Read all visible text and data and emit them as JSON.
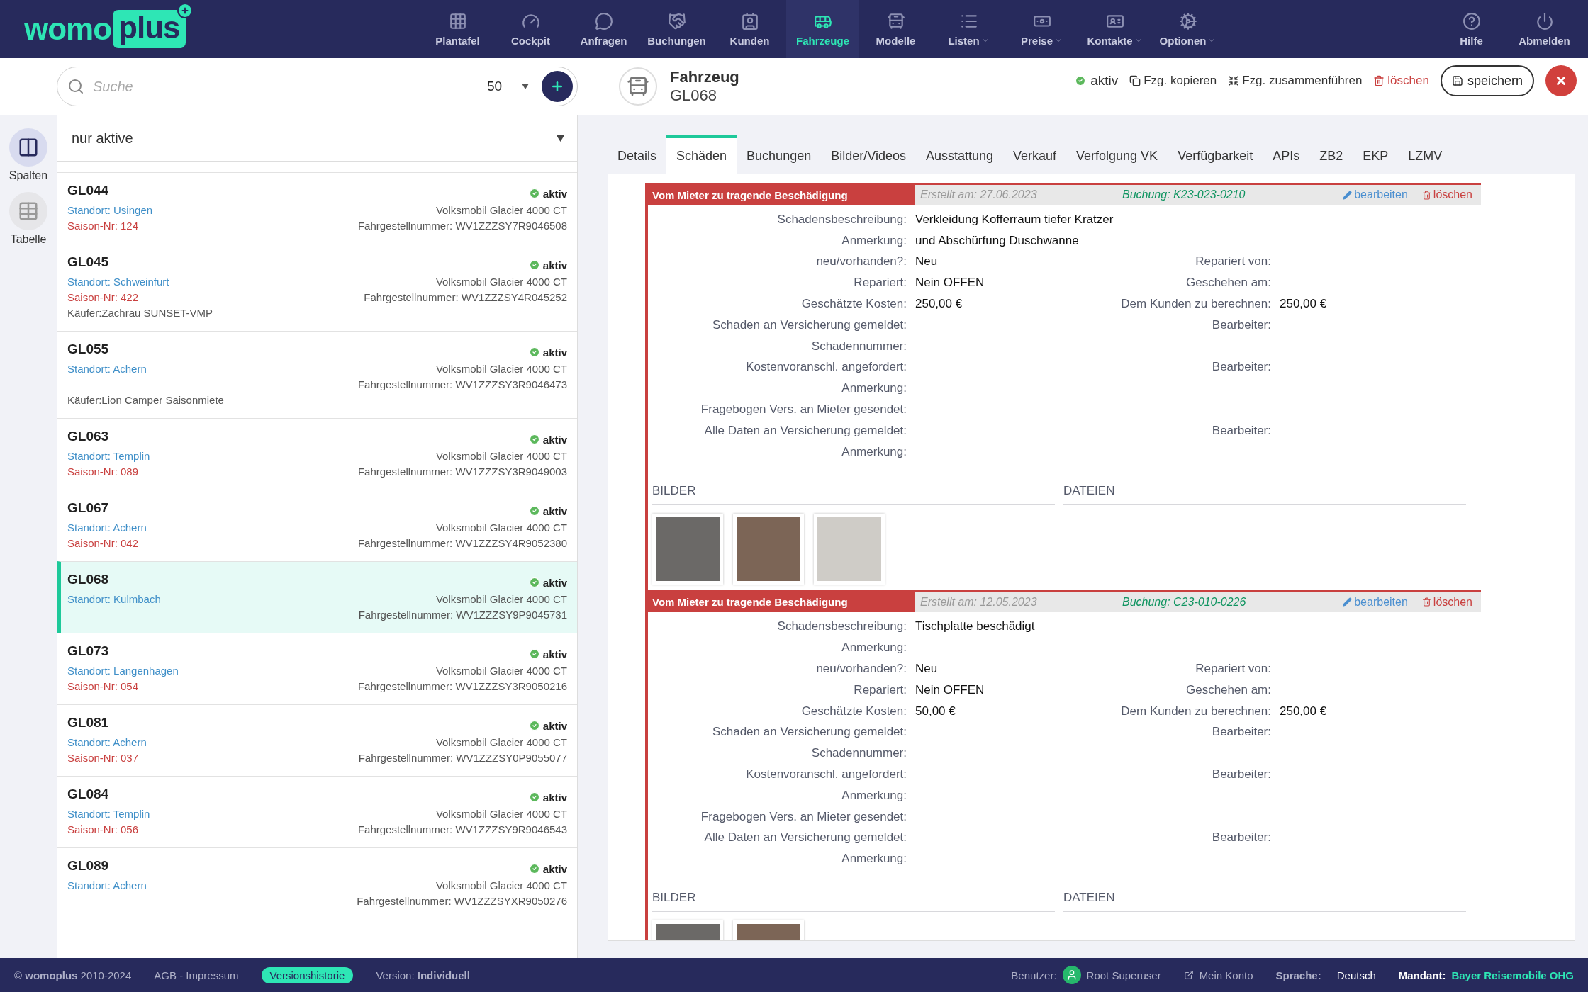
{
  "nav": {
    "logo": {
      "part1": "womo",
      "part2": "plus"
    },
    "items": [
      {
        "label": "Plantafel",
        "selected": false,
        "dropdown": false
      },
      {
        "label": "Cockpit",
        "selected": false,
        "dropdown": false
      },
      {
        "label": "Anfragen",
        "selected": false,
        "dropdown": false
      },
      {
        "label": "Buchungen",
        "selected": false,
        "dropdown": false
      },
      {
        "label": "Kunden",
        "selected": false,
        "dropdown": false
      },
      {
        "label": "Fahrzeuge",
        "selected": true,
        "dropdown": false
      },
      {
        "label": "Modelle",
        "selected": false,
        "dropdown": false
      },
      {
        "label": "Listen",
        "selected": false,
        "dropdown": true
      },
      {
        "label": "Preise",
        "selected": false,
        "dropdown": true
      },
      {
        "label": "Kontakte",
        "selected": false,
        "dropdown": true
      },
      {
        "label": "Optionen",
        "selected": false,
        "dropdown": true
      }
    ],
    "right_items": [
      {
        "label": "Hilfe"
      },
      {
        "label": "Abmelden"
      }
    ]
  },
  "search": {
    "placeholder": "Suche",
    "page_size": "50"
  },
  "filter": {
    "value": "nur aktive"
  },
  "rail": [
    {
      "label": "Spalten",
      "selected": true
    },
    {
      "label": "Tabelle",
      "selected": false
    }
  ],
  "vehicles": [
    {
      "code": "GL044",
      "status": "aktiv",
      "location": "Standort: Usingen",
      "season": "Saison-Nr: 124",
      "model": "Volksmobil Glacier 4000 CT",
      "vin": "Fahrgestellnummer: WV1ZZZSY7R9046508",
      "selected": false
    },
    {
      "code": "GL045",
      "status": "aktiv",
      "location": "Standort: Schweinfurt",
      "season": "Saison-Nr: 422",
      "model": "Volksmobil Glacier 4000 CT",
      "vin": "Fahrgestellnummer: WV1ZZZSY4R045252",
      "buyer": "Käufer:Zachrau SUNSET-VMP",
      "selected": false
    },
    {
      "code": "GL055",
      "status": "aktiv",
      "location": "Standort: Achern",
      "model": "Volksmobil Glacier 4000 CT",
      "vin": "Fahrgestellnummer: WV1ZZZSY3R9046473",
      "buyer": "Käufer:Lion Camper Saisonmiete",
      "selected": false
    },
    {
      "code": "GL063",
      "status": "aktiv",
      "location": "Standort: Templin",
      "season": "Saison-Nr: 089",
      "model": "Volksmobil Glacier 4000 CT",
      "vin": "Fahrgestellnummer: WV1ZZZSY3R9049003",
      "selected": false
    },
    {
      "code": "GL067",
      "status": "aktiv",
      "location": "Standort: Achern",
      "season": "Saison-Nr: 042",
      "model": "Volksmobil Glacier 4000 CT",
      "vin": "Fahrgestellnummer: WV1ZZZSY4R9052380",
      "selected": false
    },
    {
      "code": "GL068",
      "status": "aktiv",
      "location": "Standort: Kulmbach",
      "model": "Volksmobil Glacier 4000 CT",
      "vin": "Fahrgestellnummer: WV1ZZZSY9P9045731",
      "selected": true
    },
    {
      "code": "GL073",
      "status": "aktiv",
      "location": "Standort: Langenhagen",
      "season": "Saison-Nr: 054",
      "model": "Volksmobil Glacier 4000 CT",
      "vin": "Fahrgestellnummer: WV1ZZZSY3R9050216",
      "selected": false
    },
    {
      "code": "GL081",
      "status": "aktiv",
      "location": "Standort: Achern",
      "season": "Saison-Nr: 037",
      "model": "Volksmobil Glacier 4000 CT",
      "vin": "Fahrgestellnummer: WV1ZZZSY0P9055077",
      "selected": false
    },
    {
      "code": "GL084",
      "status": "aktiv",
      "location": "Standort: Templin",
      "season": "Saison-Nr: 056",
      "model": "Volksmobil Glacier 4000 CT",
      "vin": "Fahrgestellnummer: WV1ZZZSY9R9046543",
      "selected": false
    },
    {
      "code": "GL089",
      "status": "aktiv",
      "location": "Standort: Achern",
      "model": "Volksmobil Glacier 4000 CT",
      "vin": "Fahrgestellnummer: WV1ZZZSYXR9050276",
      "selected": false
    }
  ],
  "detail": {
    "title": "Fahrzeug",
    "code": "GL068",
    "status": "aktiv",
    "copy": "Fzg. kopieren",
    "merge": "Fzg. zusammenführen",
    "delete": "löschen",
    "save": "speichern"
  },
  "tabs": [
    {
      "label": "Details",
      "selected": false
    },
    {
      "label": "Schäden",
      "selected": true
    },
    {
      "label": "Buchungen",
      "selected": false
    },
    {
      "label": "Bilder/Videos",
      "selected": false
    },
    {
      "label": "Ausstattung",
      "selected": false
    },
    {
      "label": "Verkauf",
      "selected": false
    },
    {
      "label": "Verfolgung VK",
      "selected": false
    },
    {
      "label": "Verfügbarkeit",
      "selected": false
    },
    {
      "label": "APIs",
      "selected": false
    },
    {
      "label": "ZB2",
      "selected": false
    },
    {
      "label": "EKP",
      "selected": false
    },
    {
      "label": "LZMV",
      "selected": false
    }
  ],
  "damages": [
    {
      "title": "Vom Mieter zu tragende Beschädigung",
      "created": "Erstellt am: 27.06.2023",
      "booking": "Buchung: K23-023-0210",
      "edit": "bearbeiten",
      "delete": "löschen",
      "rows": [
        {
          "label": "Schadensbeschreibung:",
          "value": "Verkleidung Kofferraum tiefer Kratzer"
        },
        {
          "label": "Anmerkung:",
          "value": "und Abschürfung Duschwanne"
        },
        {
          "label": "neu/vorhanden?:",
          "value": "Neu",
          "right_label": "Repariert von:"
        },
        {
          "label": "Repariert:",
          "value": "Nein OFFEN",
          "right_label": "Geschehen am:"
        },
        {
          "label": "Geschätzte Kosten:",
          "value": "250,00 €",
          "right_label": "Dem Kunden zu berechnen:",
          "right_value": "250,00 €"
        },
        {
          "label": "Schaden an Versicherung gemeldet:",
          "right_label": "Bearbeiter:"
        },
        {
          "label": "Schadennummer:"
        },
        {
          "label": "Kostenvoranschl. angefordert:",
          "right_label": "Bearbeiter:"
        },
        {
          "label": "Anmerkung:"
        },
        {
          "label": "Fragebogen Vers. an Mieter gesendet:"
        },
        {
          "label": "Alle Daten an Versicherung gemeldet:",
          "right_label": "Bearbeiter:"
        },
        {
          "label": "Anmerkung:"
        }
      ],
      "images_heading": "BILDER",
      "files_heading": "DATEIEN",
      "images": [
        {
          "kind": "photo"
        },
        {
          "kind": "photo"
        },
        {
          "kind": "photo"
        }
      ]
    },
    {
      "title": "Vom Mieter zu tragende Beschädigung",
      "created": "Erstellt am: 12.05.2023",
      "booking": "Buchung: C23-010-0226",
      "edit": "bearbeiten",
      "delete": "löschen",
      "rows": [
        {
          "label": "Schadensbeschreibung:",
          "value": "Tischplatte beschädigt"
        },
        {
          "label": "Anmerkung:"
        },
        {
          "label": "neu/vorhanden?:",
          "value": "Neu",
          "right_label": "Repariert von:"
        },
        {
          "label": "Repariert:",
          "value": "Nein OFFEN",
          "right_label": "Geschehen am:"
        },
        {
          "label": "Geschätzte Kosten:",
          "value": "50,00 €",
          "right_label": "Dem Kunden zu berechnen:",
          "right_value": "250,00 €"
        },
        {
          "label": "Schaden an Versicherung gemeldet:",
          "right_label": "Bearbeiter:"
        },
        {
          "label": "Schadennummer:"
        },
        {
          "label": "Kostenvoranschl. angefordert:",
          "right_label": "Bearbeiter:"
        },
        {
          "label": "Anmerkung:"
        },
        {
          "label": "Fragebogen Vers. an Mieter gesendet:"
        },
        {
          "label": "Alle Daten an Versicherung gemeldet:",
          "right_label": "Bearbeiter:"
        },
        {
          "label": "Anmerkung:"
        }
      ],
      "images_heading": "BILDER",
      "files_heading": "DATEIEN",
      "images": [
        {
          "kind": "photo"
        },
        {
          "kind": "photo"
        }
      ]
    }
  ],
  "footer": {
    "copyright": "© **womoplus** 2010-2024",
    "legal": "AGB - Impressum",
    "history": "Versionshistorie",
    "version": "Version: **Individuell**",
    "user_label": "Benutzer:",
    "user": "Root Superuser",
    "account": "Mein Konto",
    "language_label": "Sprache:",
    "language": "Deutsch",
    "client_label": "Mandant:",
    "client": "Bayer Reisemobile OHG"
  }
}
